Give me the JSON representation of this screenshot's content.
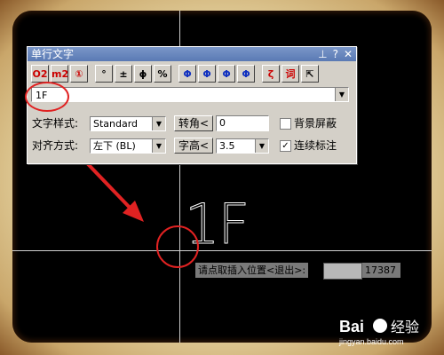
{
  "dialog": {
    "title": "单行文字",
    "title_icons": [
      "pin-icon",
      "help-icon",
      "close-icon"
    ],
    "toolbar": [
      "O2",
      "m2",
      "①",
      "°",
      "±",
      "ϕ",
      "%",
      "Φ",
      "Φ",
      "Φ",
      "Φ",
      "ζ",
      "词",
      "⇱"
    ],
    "text_value": "1F",
    "style_label": "文字样式:",
    "style_value": "Standard",
    "rotate_button": "转角<",
    "rotate_value": "0",
    "mask_label": "背景屏蔽",
    "mask_checked": false,
    "align_label": "对齐方式:",
    "align_value": "左下 (BL)",
    "height_button": "字高<",
    "height_value": "3.5",
    "continuous_label": "连续标注",
    "continuous_checked": true
  },
  "canvas": {
    "drawn_text": "1F",
    "prompt_text": "请点取插入位置<退出>:",
    "coord_value": "17387"
  },
  "watermark": {
    "brand": "Bai",
    "brand2": "经验",
    "url": "jingyan.baidu.com"
  },
  "colors": {
    "accent_red": "#e02222",
    "title_blue": "#5a7ab4"
  }
}
